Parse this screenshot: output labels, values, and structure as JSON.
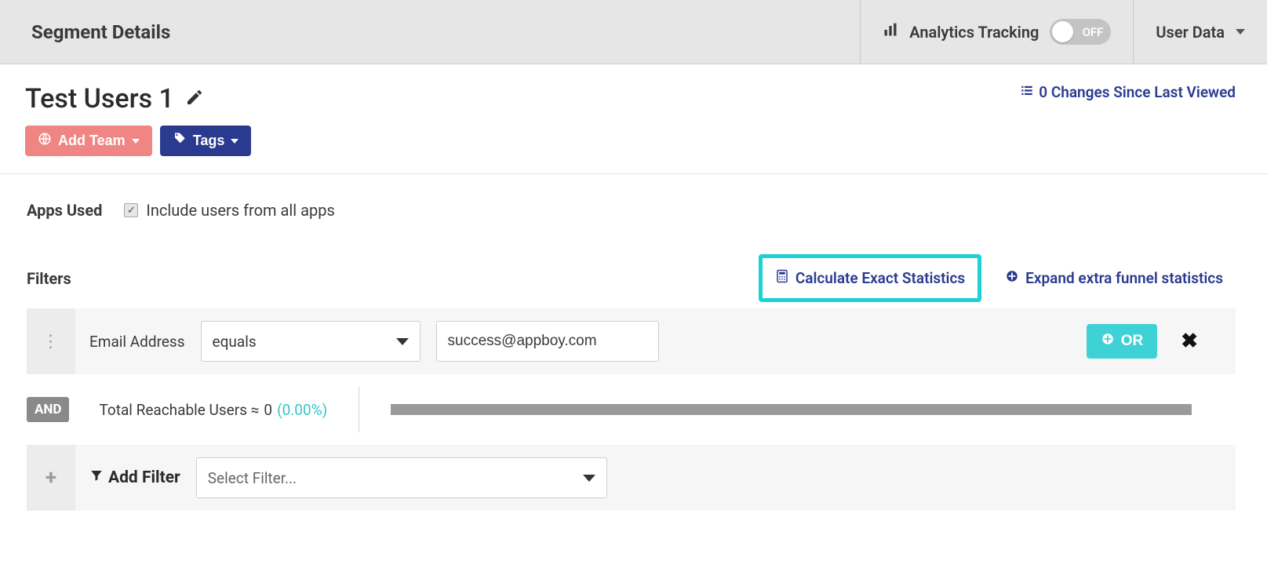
{
  "header": {
    "title": "Segment Details",
    "analytics_label": "Analytics Tracking",
    "analytics_state": "OFF",
    "user_data_label": "User Data"
  },
  "segment": {
    "name": "Test Users 1",
    "changes_link": "0 Changes Since Last Viewed",
    "add_team_label": "Add Team",
    "tags_label": "Tags"
  },
  "apps": {
    "section_label": "Apps Used",
    "include_all_label": "Include users from all apps",
    "include_all_checked": true
  },
  "filters": {
    "section_label": "Filters",
    "calc_label": "Calculate Exact Statistics",
    "expand_label": "Expand extra funnel statistics",
    "row": {
      "field_label": "Email Address",
      "operator": "equals",
      "value": "success@appboy.com",
      "or_label": "OR"
    },
    "and_label": "AND",
    "reach_prefix": "Total Reachable Users ≈",
    "reach_count": "0",
    "reach_pct": "(0.00%)",
    "add_filter_label": "Add Filter",
    "select_placeholder": "Select Filter..."
  }
}
